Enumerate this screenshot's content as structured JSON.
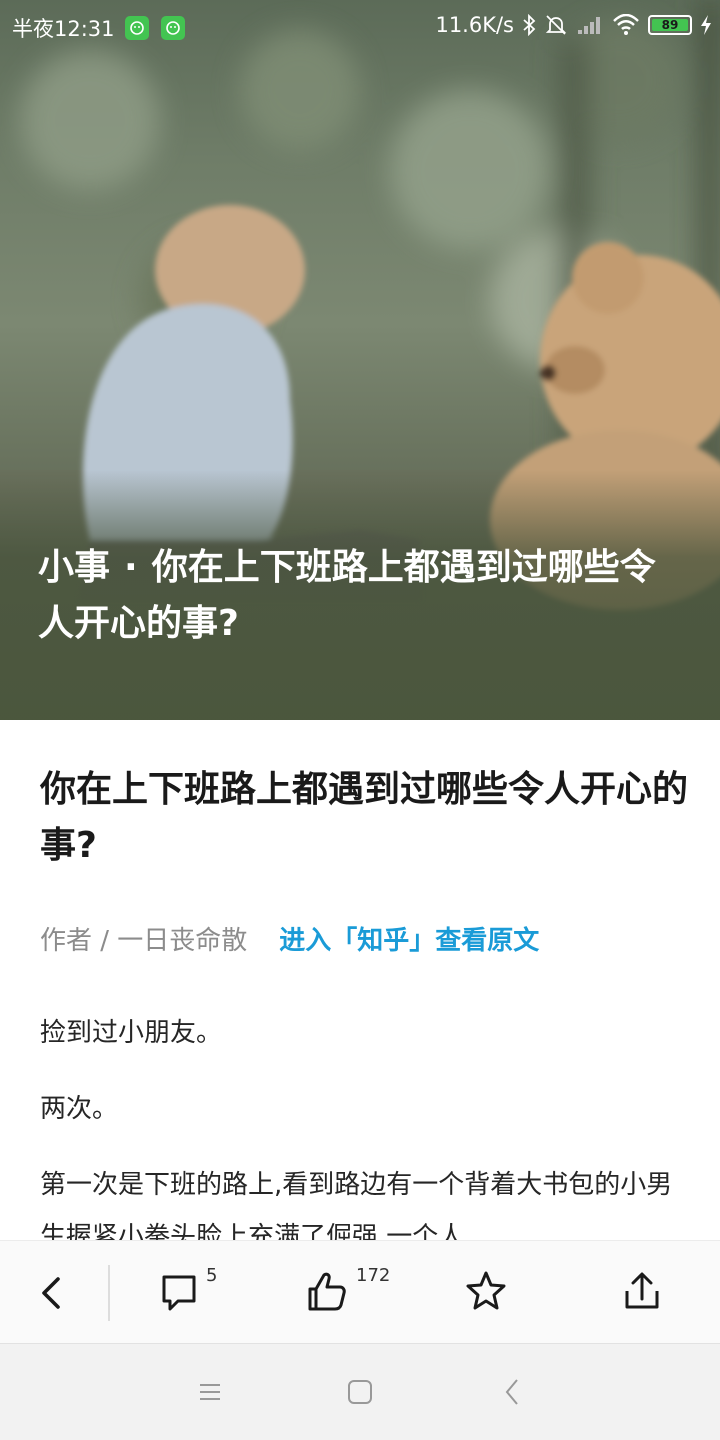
{
  "status_bar": {
    "time": "半夜12:31",
    "network_speed": "11.6K/s",
    "battery_level": "89",
    "icons": [
      "app-badge-icon",
      "app-badge-icon",
      "bluetooth-icon",
      "mute-icon",
      "signal-icon",
      "wifi-icon",
      "battery-icon",
      "charging-icon"
    ]
  },
  "hero": {
    "title_prefix": "小事",
    "separator": "·",
    "title": "你在上下班路上都遇到过哪些令人开心的事?"
  },
  "article": {
    "title": "你在上下班路上都遇到过哪些令人开心的事?",
    "author": "作者 / 一日丧命散",
    "source_link": "进入「知乎」查看原文",
    "paragraphs": [
      "捡到过小朋友。",
      "两次。",
      "第一次是下班的路上,看到路边有一个背着大书包的小男生握紧小拳头脸上充满了倔强,一个人"
    ]
  },
  "action_bar": {
    "comment_count": "5",
    "like_count": "172",
    "icons": [
      "back-icon",
      "comment-icon",
      "like-icon",
      "star-icon",
      "share-icon"
    ]
  },
  "colors": {
    "accent_link": "#1a9bd7",
    "badge_green": "#43c451"
  }
}
